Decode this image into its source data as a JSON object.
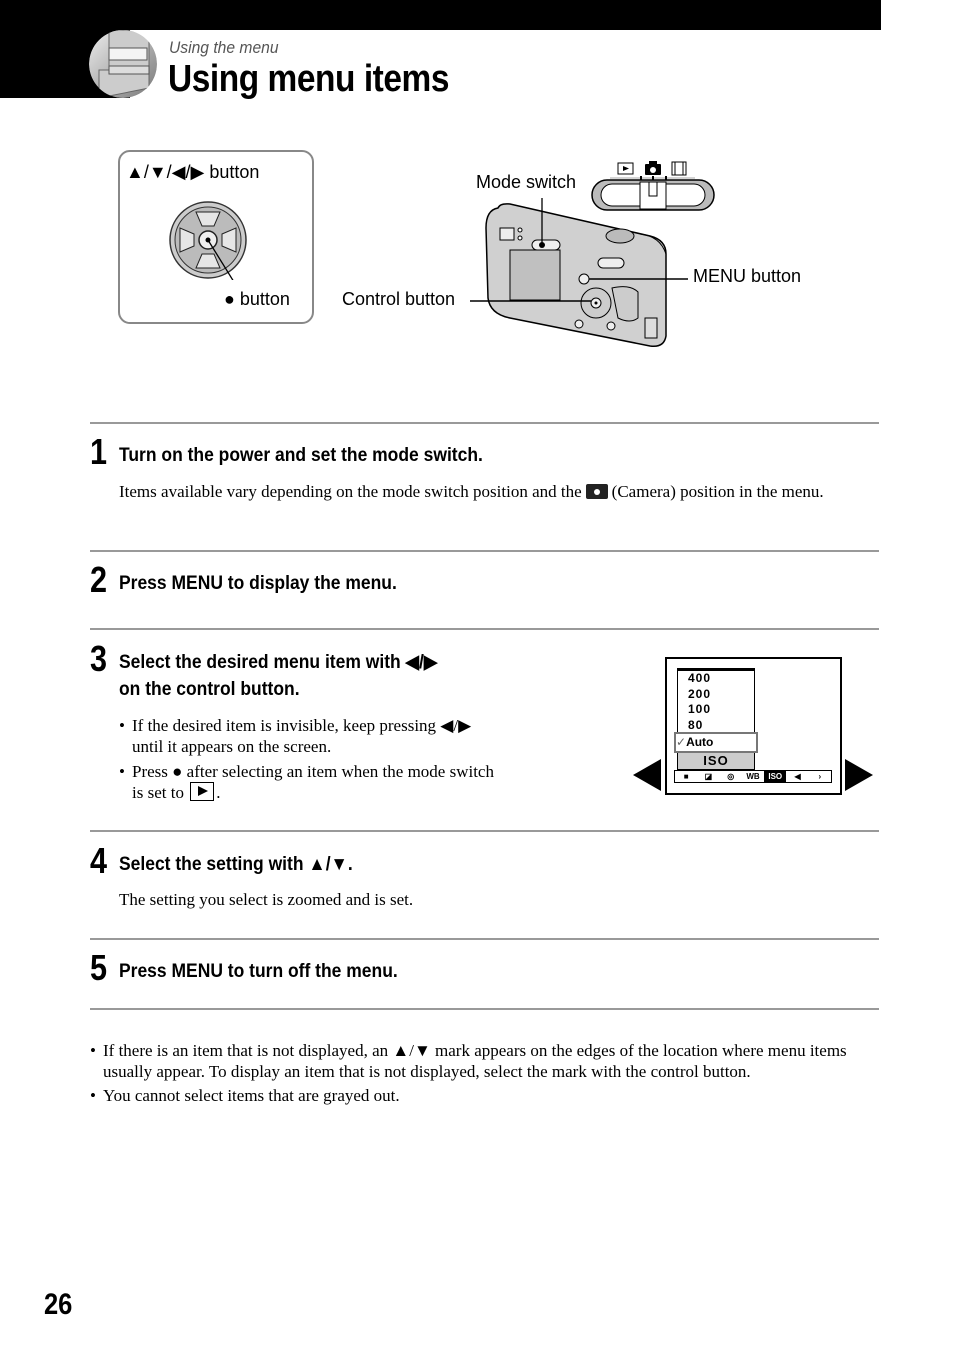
{
  "header": {
    "section": "Using the menu",
    "title": "Using menu items"
  },
  "diagram": {
    "dpad_label": "▲/▼/◀/▶ button",
    "center_label": "● button",
    "mode_switch_label": "Mode switch",
    "menu_button_label": "MENU button",
    "control_button_label": "Control button",
    "mode_positions": [
      "playback-icon",
      "camera-icon",
      "movie-icon"
    ]
  },
  "steps": [
    {
      "number": "1",
      "title": "Turn on the power and set the mode switch.",
      "body_before_icon": "Items available vary depending on the mode switch position and the",
      "body_after_icon": "(Camera) position in the menu."
    },
    {
      "number": "2",
      "title": "Press MENU to display the menu."
    },
    {
      "number": "3",
      "title_line1": "Select the desired menu item with ◀/▶",
      "title_line2": "on the control button.",
      "bullets": [
        "If the desired item is invisible, keep pressing ◀/▶ until it appears on the screen.",
        "Press ● after selecting an item when the mode switch is set to"
      ],
      "bullet2_suffix": "."
    },
    {
      "number": "4",
      "title": "Select the setting with ▲/▼.",
      "body": "The setting you select is zoomed and is set."
    },
    {
      "number": "5",
      "title": "Press MENU to turn off the menu."
    }
  ],
  "screen": {
    "iso_options": [
      "400",
      "200",
      "100",
      "80"
    ],
    "selected": "Auto",
    "check": "✓",
    "item_label": "ISO",
    "menu_bar": [
      "camera-icon",
      "exposure-icon",
      "focus-icon",
      "WB",
      "ISO",
      "quality-icon",
      "›"
    ],
    "menu_bar_active": "ISO"
  },
  "notes": [
    "If there is an item that is not displayed, an ▲/▼ mark appears on the edges of the location where menu items usually appear. To display an item that is not displayed, select the mark with the control button.",
    "You cannot select items that are grayed out."
  ],
  "page_number": "26"
}
